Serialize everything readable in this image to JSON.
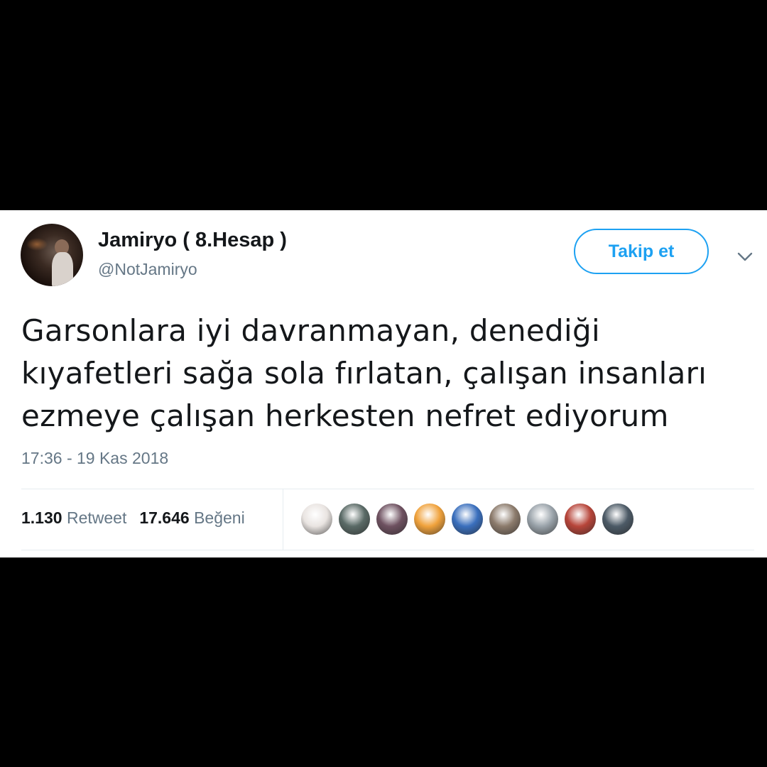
{
  "tweet": {
    "display_name": "Jamiryo ( 8.Hesap )",
    "handle": "@NotJamiryo",
    "follow_label": "Takip et",
    "text": "Garsonlara iyi davranmayan, denediği kıyafetleri sağa sola fırlatan, çalışan insanları ezmeye çalışan herkesten nefret ediyorum",
    "timestamp": "17:36 - 19 Kas 2018",
    "retweets_count": "1.130",
    "retweets_label": "Retweet",
    "likes_count": "17.646",
    "likes_label": "Beğeni"
  },
  "likers": [
    {
      "icon": "liker-avatar-1",
      "color": "#e9e4e1"
    },
    {
      "icon": "liker-avatar-2",
      "color": "#5a6a66"
    },
    {
      "icon": "liker-avatar-3",
      "color": "#6e5160"
    },
    {
      "icon": "liker-avatar-4",
      "color": "#f0a23c"
    },
    {
      "icon": "liker-avatar-5",
      "color": "#3a6fbd"
    },
    {
      "icon": "liker-avatar-6",
      "color": "#8c7b6c"
    },
    {
      "icon": "liker-avatar-7",
      "color": "#9aa3aa"
    },
    {
      "icon": "liker-avatar-8",
      "color": "#b7453a"
    },
    {
      "icon": "liker-avatar-9",
      "color": "#4c5a66"
    }
  ],
  "colors": {
    "accent": "#1da1f2",
    "text": "#14171a",
    "muted": "#657786",
    "divider": "#e6ecf0"
  }
}
